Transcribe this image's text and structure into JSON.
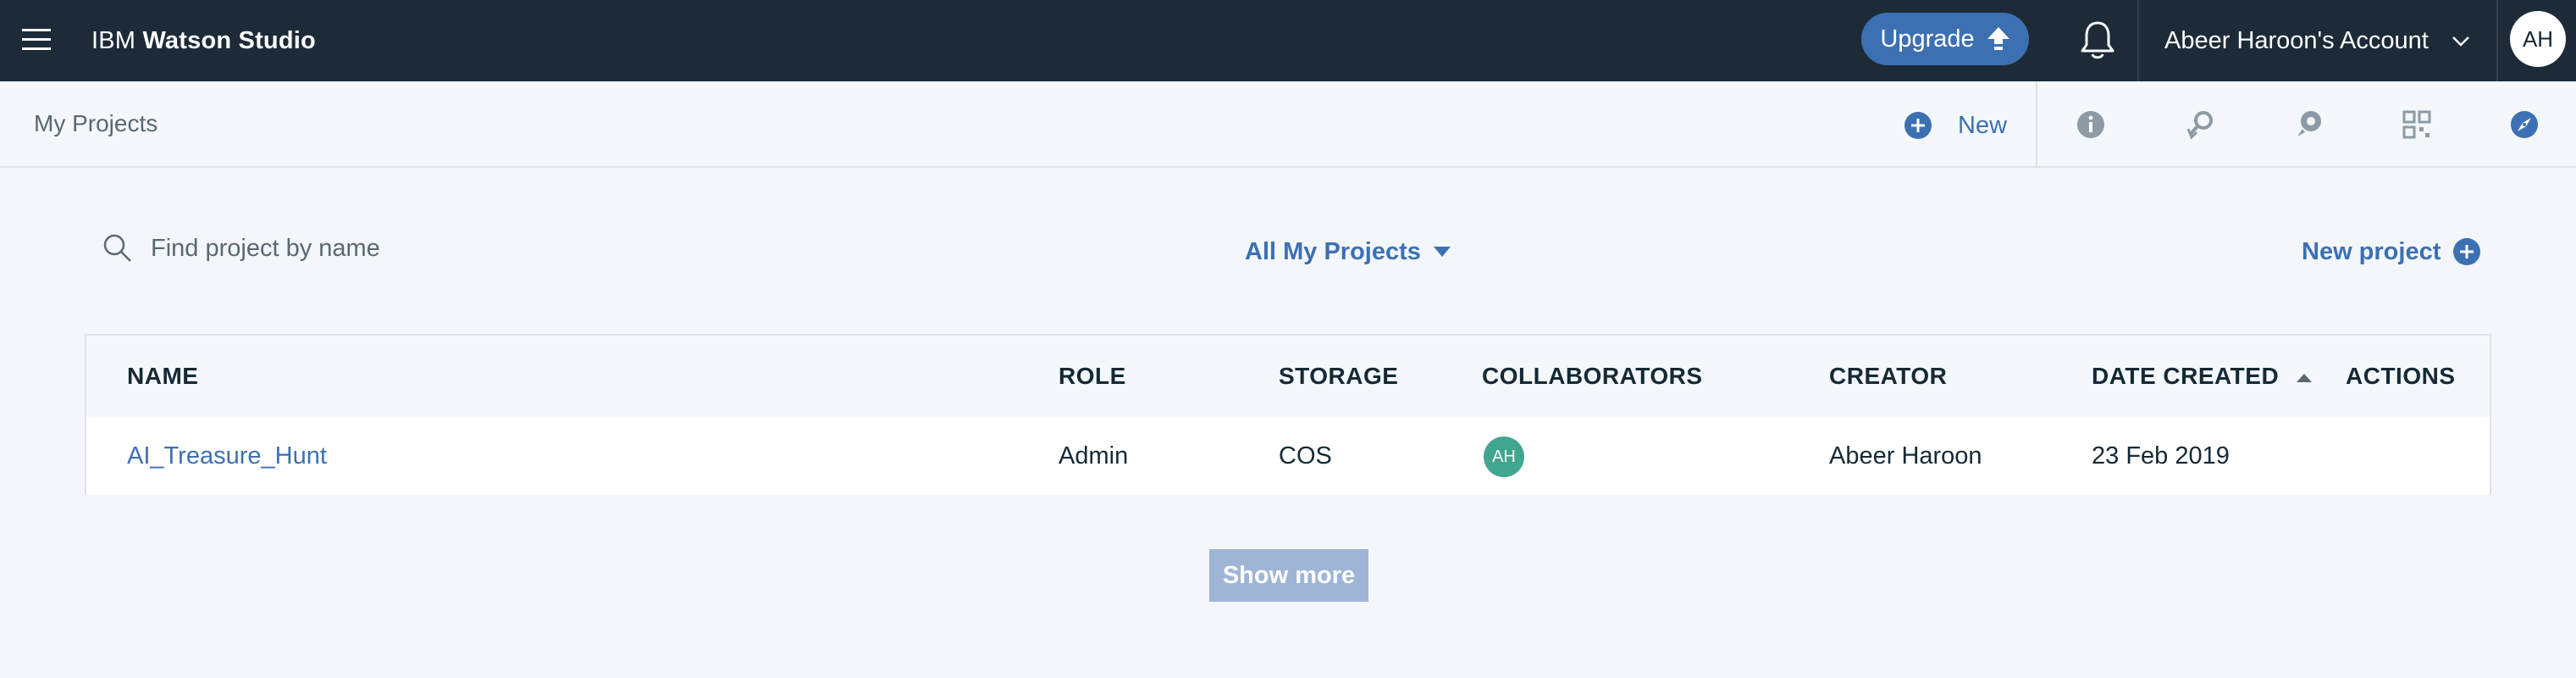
{
  "topbar": {
    "brand_prefix": "IBM",
    "brand_name": "Watson Studio",
    "upgrade_label": "Upgrade",
    "account_label": "Abeer Haroon's Account",
    "avatar_initials": "AH",
    "bg_color": "#1d2b38"
  },
  "subbar": {
    "breadcrumb": "My Projects",
    "new_label": "New",
    "tools": [
      "info-icon",
      "find-data-icon",
      "community-icon",
      "services-icon",
      "compass-icon"
    ]
  },
  "controls": {
    "search_placeholder": "Find project by name",
    "search_value": "",
    "filter_label": "All My Projects",
    "new_project_label": "New project"
  },
  "table": {
    "columns": [
      "NAME",
      "ROLE",
      "STORAGE",
      "COLLABORATORS",
      "CREATOR",
      "DATE CREATED",
      "ACTIONS"
    ],
    "sorted_column": "DATE CREATED",
    "sort_direction": "ascending",
    "rows": [
      {
        "name": "AI_Treasure_Hunt",
        "role": "Admin",
        "storage": "COS",
        "collaborator_initials": "AH",
        "creator": "Abeer Haroon",
        "date_created": "23 Feb 2019"
      }
    ]
  },
  "show_more_label": "Show more",
  "colors": {
    "accent": "#3d70b2",
    "collaborator_avatar": "#41a68f",
    "show_more_disabled": "#9fb5d6"
  }
}
